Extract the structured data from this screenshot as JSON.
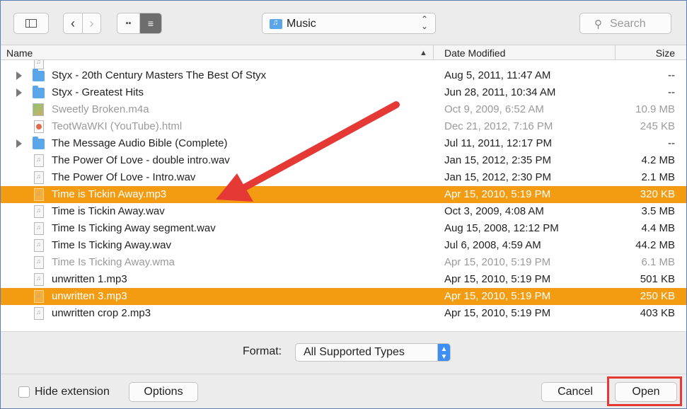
{
  "toolbar": {
    "location_label": "Music",
    "search_placeholder": "Search"
  },
  "columns": {
    "name": "Name",
    "date_modified": "Date Modified",
    "size": "Size"
  },
  "rows": [
    {
      "kind": "folder",
      "expandable": true,
      "name": "Styx - 20th Century Masters The Best Of Styx",
      "date": "Aug 5, 2011, 11:47 AM",
      "size": "--",
      "state": "normal"
    },
    {
      "kind": "folder",
      "expandable": true,
      "name": "Styx - Greatest Hits",
      "date": "Jun 28, 2011, 10:34 AM",
      "size": "--",
      "state": "normal"
    },
    {
      "kind": "audio",
      "expandable": false,
      "name": "Sweetly Broken.m4a",
      "date": "Oct 9, 2009, 6:52 AM",
      "size": "10.9 MB",
      "state": "dim"
    },
    {
      "kind": "html",
      "expandable": false,
      "name": "TeotWaWKI (YouTube).html",
      "date": "Dec 21, 2012, 7:16 PM",
      "size": "245 KB",
      "state": "dim"
    },
    {
      "kind": "folder",
      "expandable": true,
      "name": "The Message Audio Bible (Complete)",
      "date": "Jul 11, 2011, 12:17 PM",
      "size": "--",
      "state": "normal"
    },
    {
      "kind": "file",
      "expandable": false,
      "name": "The Power Of Love - double intro.wav",
      "date": "Jan 15, 2012, 2:35 PM",
      "size": "4.2 MB",
      "state": "normal"
    },
    {
      "kind": "file",
      "expandable": false,
      "name": "The Power Of Love - Intro.wav",
      "date": "Jan 15, 2012, 2:30 PM",
      "size": "2.1 MB",
      "state": "normal"
    },
    {
      "kind": "file",
      "expandable": false,
      "name": "Time is Tickin Away.mp3",
      "date": "Apr 15, 2010, 5:19 PM",
      "size": "320 KB",
      "state": "selected"
    },
    {
      "kind": "file",
      "expandable": false,
      "name": "Time is Tickin Away.wav",
      "date": "Oct 3, 2009, 4:08 AM",
      "size": "3.5 MB",
      "state": "normal"
    },
    {
      "kind": "file",
      "expandable": false,
      "name": "Time Is Ticking Away segment.wav",
      "date": "Aug 15, 2008, 12:12 PM",
      "size": "4.4 MB",
      "state": "normal"
    },
    {
      "kind": "file",
      "expandable": false,
      "name": "Time Is Ticking Away.wav",
      "date": "Jul 6, 2008, 4:59 AM",
      "size": "44.2 MB",
      "state": "normal"
    },
    {
      "kind": "file",
      "expandable": false,
      "name": "Time Is Ticking Away.wma",
      "date": "Apr 15, 2010, 5:19 PM",
      "size": "6.1 MB",
      "state": "dim"
    },
    {
      "kind": "file",
      "expandable": false,
      "name": "unwritten 1.mp3",
      "date": "Apr 15, 2010, 5:19 PM",
      "size": "501 KB",
      "state": "normal"
    },
    {
      "kind": "file",
      "expandable": false,
      "name": "unwritten 3.mp3",
      "date": "Apr 15, 2010, 5:19 PM",
      "size": "250 KB",
      "state": "selected"
    },
    {
      "kind": "file",
      "expandable": false,
      "name": "unwritten crop 2.mp3",
      "date": "Apr 15, 2010, 5:19 PM",
      "size": "403 KB",
      "state": "normal"
    }
  ],
  "format": {
    "label": "Format:",
    "value": "All Supported Types"
  },
  "bottom": {
    "hide_extension_label": "Hide extension",
    "options_label": "Options",
    "cancel_label": "Cancel",
    "open_label": "Open"
  },
  "colors": {
    "selection": "#f39c12",
    "annotation": "#e53935",
    "folder": "#5aa6e8"
  }
}
